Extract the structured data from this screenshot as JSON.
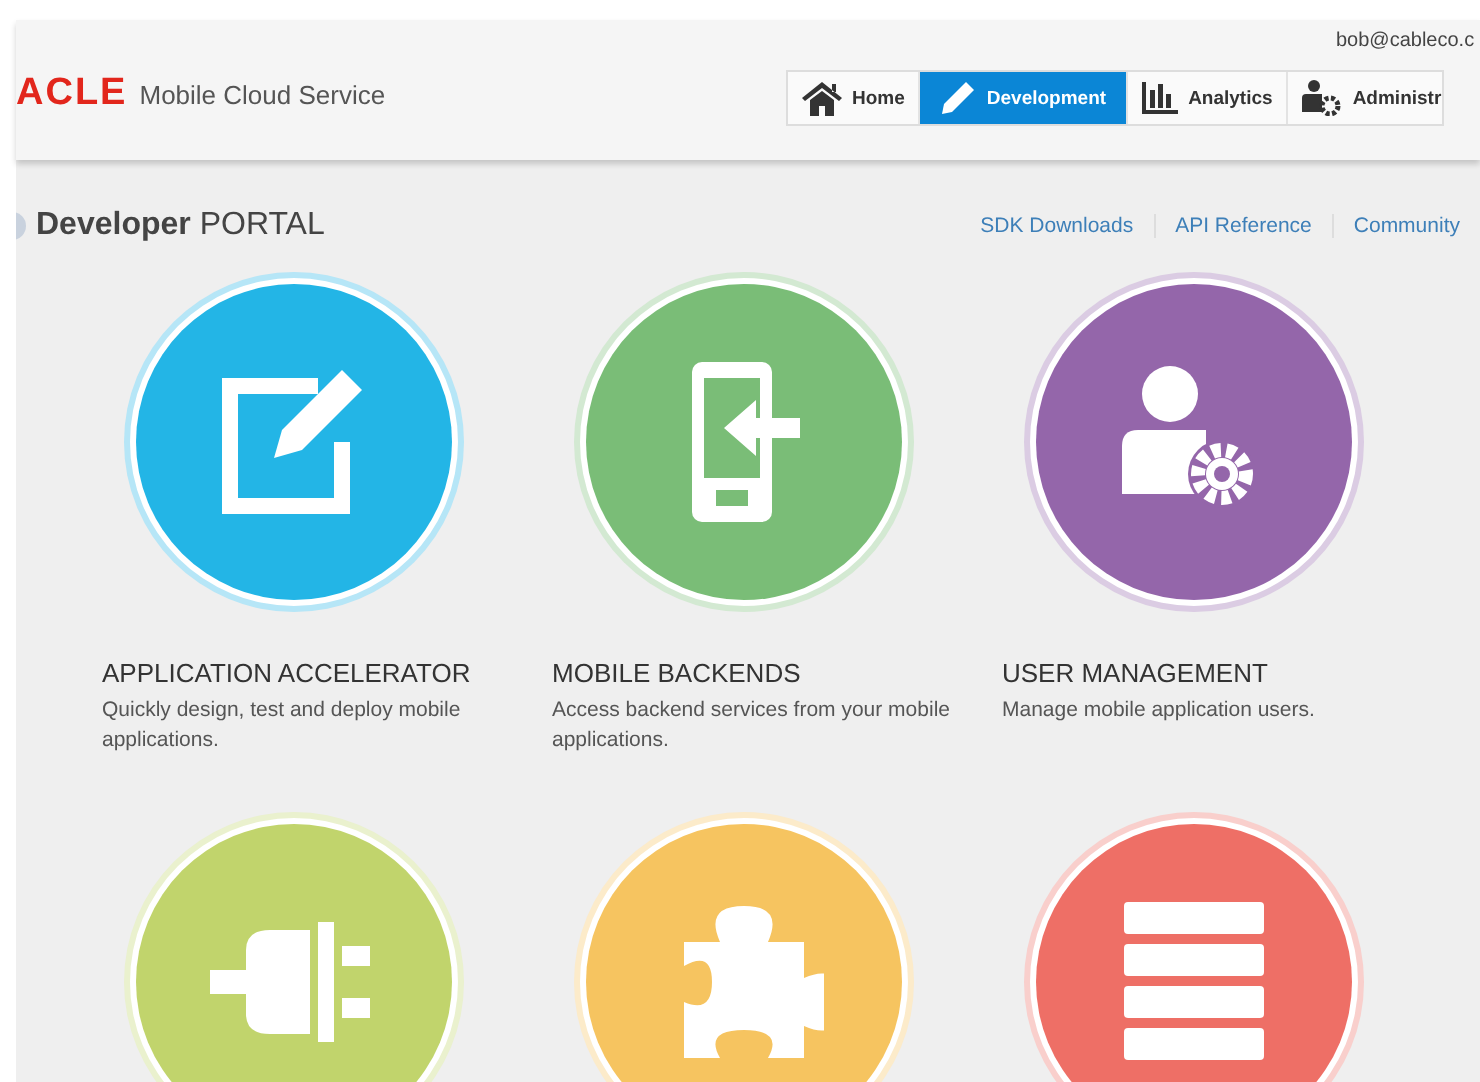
{
  "header": {
    "logo": "ACLE",
    "product": "Mobile Cloud Service",
    "user": "bob@cableco.c",
    "tabs": [
      {
        "label": "Home",
        "kind": "home",
        "selected": false
      },
      {
        "label": "Development",
        "kind": "pencil",
        "selected": true
      },
      {
        "label": "Analytics",
        "kind": "chart",
        "selected": false
      },
      {
        "label": "Administr",
        "kind": "admin",
        "selected": false
      }
    ]
  },
  "portal": {
    "title": "**Developer** PORTAL",
    "links": [
      "SDK Downloads",
      "API Reference",
      "Community"
    ]
  },
  "tiles": [
    {
      "kind": "editor",
      "color": "#23b5e6",
      "title": "APPLICATION ACCELERATOR",
      "description": "Quickly design, test and deploy mobile applications."
    },
    {
      "kind": "phone",
      "color": "#7abd77",
      "title": "MOBILE BACKENDS",
      "description": "Access backend services from your mobile applications."
    },
    {
      "kind": "user-gear",
      "color": "#9466aa",
      "title": "USER MANAGEMENT",
      "description": "Manage mobile application users."
    },
    {
      "kind": "plug",
      "color": "#c1d46c"
    },
    {
      "kind": "puzzle",
      "color": "#f6c460"
    },
    {
      "kind": "list",
      "color": "#ee6f66"
    }
  ]
}
